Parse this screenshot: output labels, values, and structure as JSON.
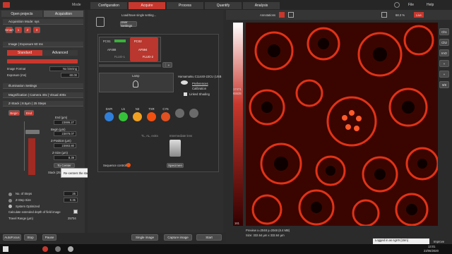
{
  "app": {
    "title": "Mode"
  },
  "top_tabs": [
    "Configuration",
    "Acquire",
    "Process",
    "Quantify",
    "Analysis"
  ],
  "window_controls": {
    "file": "File",
    "help": "Help"
  },
  "left": {
    "tabs": [
      "Open projects",
      "Acquisition"
    ],
    "acq_mode": "Acquisition Mode: sys",
    "acq_buttons": [
      "Smart",
      "1",
      "Z",
      "3"
    ],
    "image_exposure": "Image | Exposure 60 ms",
    "std_adv": [
      "Standard",
      "Advanced"
    ],
    "image_format": {
      "label": "Image Format",
      "value": "No binning"
    },
    "exposure": {
      "label": "Exposure (ms)",
      "value": "60.00"
    },
    "illumination": "Illumination Settings",
    "magnification": "Magnification | Camera 40x | Visual 400x",
    "zstack": "Z-Stack | 8.5µm | 25 Steps",
    "begin_end": [
      "Begin",
      "End"
    ],
    "end": {
      "label": "End (µm)",
      "value": "23886.27"
    },
    "begin": {
      "label": "Begin (µm)",
      "value": "23878.07"
    },
    "zpos": {
      "label": "Z-Position (µm)",
      "value": "23883.80"
    },
    "zsize": {
      "label": "Z-Size (µm)",
      "value": "8.39"
    },
    "center_btn": "To Center",
    "stack": "Stack (25)",
    "tooltip": "Re-centers the stack around current z-position",
    "steps": {
      "label": "No. of Steps",
      "value": "25"
    },
    "stepsize": {
      "label": "Z-Step Size",
      "value": "0.35"
    },
    "sys_opt": "System Optimized",
    "calc": "Calculate extended depth of field image",
    "travel": {
      "label": "Travel Range (µm)",
      "value": "25704"
    }
  },
  "middle": {
    "load_save": "Load/Save single setting...",
    "user_settings": "User Settings",
    "fcs": [
      "FCS1",
      "FCS2"
    ],
    "fcs_values": [
      "AF488",
      "AF594"
    ],
    "fcs_sub": [
      "FLUO-1",
      "FLUO-2"
    ],
    "lamp": "Lamp",
    "camera": "Hamamatsu C11440-22CU (USB",
    "options": [
      "Preferences",
      "Calibration",
      "Linked Shading"
    ],
    "filters": [
      "DAPI",
      "L5",
      "N3",
      "TXR",
      "CY5",
      "",
      ""
    ],
    "filter_colors": [
      "#2f7fd8",
      "#35c23a",
      "#f0a020",
      "#f05010",
      "#e05020",
      "#6a6a6a",
      "#6a6a6a"
    ],
    "lower_labels": [
      "TL, AL, extra",
      "Intermediate lens",
      "Illumination"
    ],
    "specimen": "Specimen",
    "seq": "Sequence controlled"
  },
  "viewer": {
    "annotations": "Annotations",
    "zoom": "68.3 %",
    "live": "Live",
    "side_btns": [
      "Ch1",
      "Ch2",
      "ImO",
      "+",
      "+",
      "9/8"
    ],
    "hist_top": "17471",
    "hist_mid": "65535",
    "hist_bot": "161",
    "preview": "Preview x=2048 y=2048 (8.4 MB)",
    "size": "Size: 332.64 µm x 332.64 µm"
  },
  "bottom": {
    "autofocus": "AutoFocus",
    "stop": "Stop",
    "pause": "Pause",
    "single": "Single image",
    "capture": "Capture image",
    "start": "Start",
    "logged": "Logged in as ngrr9 (15m)",
    "time": "13:01",
    "date": "23/06/2020",
    "improve": "Improve"
  }
}
